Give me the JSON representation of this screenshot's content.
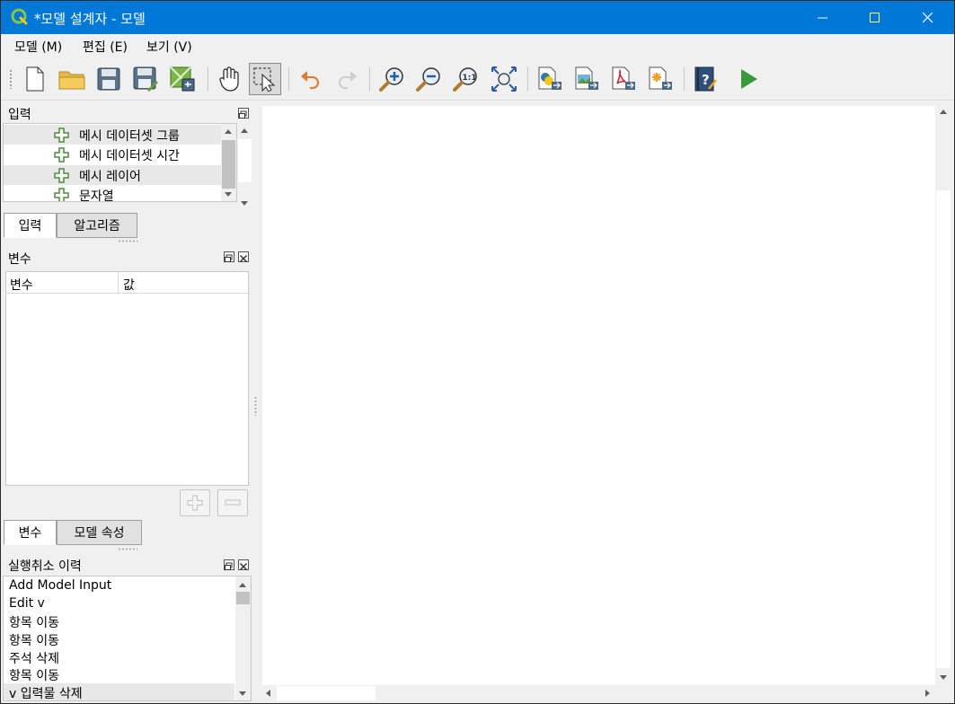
{
  "window": {
    "title": "*모델 설계자 - 모델",
    "minimize_glyph": "—",
    "maximize_glyph": "☐",
    "close_glyph": "✕"
  },
  "menu": {
    "items": [
      {
        "label": "모델 (M)"
      },
      {
        "label": "편집 (E)"
      },
      {
        "label": "보기 (V)"
      }
    ]
  },
  "toolbar": {
    "icons": [
      "new-model-icon",
      "open-model-icon",
      "save-model-icon",
      "save-as-icon",
      "save-to-project-icon",
      "pan-icon",
      "select-icon",
      "undo-icon",
      "redo-icon",
      "zoom-in-icon",
      "zoom-out-icon",
      "zoom-actual-icon",
      "zoom-full-icon",
      "export-python-icon",
      "export-image-icon",
      "export-pdf-icon",
      "export-svg-icon",
      "help-icon",
      "run-model-icon"
    ]
  },
  "inputs_panel": {
    "title": "입력",
    "items": [
      {
        "label": "메시 데이터셋 그룹"
      },
      {
        "label": "메시 데이터셋 시간"
      },
      {
        "label": "메시 레이어"
      },
      {
        "label": "문자열"
      }
    ],
    "tabs": [
      {
        "label": "입력"
      },
      {
        "label": "알고리즘"
      }
    ]
  },
  "variables_panel": {
    "title": "변수",
    "columns": [
      "변수",
      "값"
    ],
    "tabs": [
      {
        "label": "변수"
      },
      {
        "label": "모델 속성"
      }
    ]
  },
  "history_panel": {
    "title": "실행취소 이력",
    "items": [
      "Add Model Input",
      "Edit v",
      "항목 이동",
      "항목 이동",
      "주석 삭제",
      "항목 이동",
      "v 입력물 삭제"
    ]
  },
  "colors": {
    "titlebar": "#0078d7",
    "accent_green": "#4a8a3a",
    "run_green": "#3a9a3a"
  }
}
